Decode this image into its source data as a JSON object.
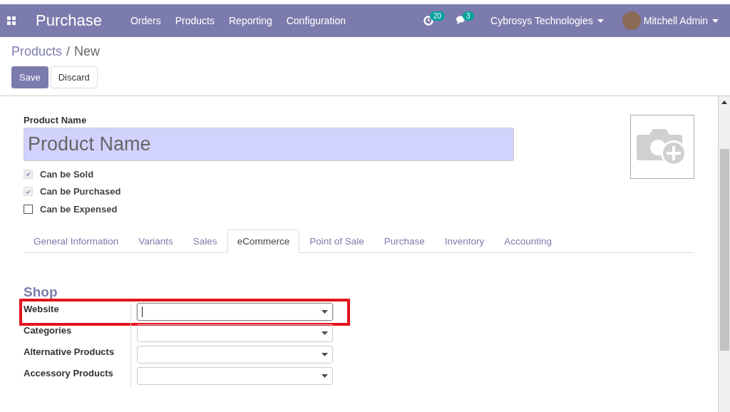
{
  "navbar": {
    "app_name": "Purchase",
    "menu": [
      "Orders",
      "Products",
      "Reporting",
      "Configuration"
    ],
    "activity_count": "20",
    "message_count": "3",
    "company": "Cybrosys Technologies",
    "user": "Mitchell Admin"
  },
  "breadcrumb": {
    "items": [
      "Products",
      "New"
    ],
    "separator": "/"
  },
  "buttons": [
    {
      "label": "Save",
      "kind": "primary"
    },
    {
      "label": "Discard",
      "kind": "secondary"
    }
  ],
  "form": {
    "name_label": "Product Name",
    "name_placeholder": "Product Name",
    "options": [
      {
        "label": "Can be Sold",
        "checked": true,
        "disabled": true
      },
      {
        "label": "Can be Purchased",
        "checked": true,
        "disabled": true
      },
      {
        "label": "Can be Expensed",
        "checked": false,
        "disabled": false
      }
    ],
    "tabs": [
      {
        "label": "General Information",
        "selected": false
      },
      {
        "label": "Variants",
        "selected": false
      },
      {
        "label": "Sales",
        "selected": false
      },
      {
        "label": "eCommerce",
        "selected": true
      },
      {
        "label": "Point of Sale",
        "selected": false
      },
      {
        "label": "Purchase",
        "selected": false
      },
      {
        "label": "Inventory",
        "selected": false
      },
      {
        "label": "Accounting",
        "selected": false
      }
    ],
    "section_title": "Shop",
    "fields": [
      {
        "label": "Website",
        "highlighted": true,
        "focused": true
      },
      {
        "label": "Categories",
        "highlighted": false,
        "focused": false
      },
      {
        "label": "Alternative Products",
        "highlighted": false,
        "focused": false
      },
      {
        "label": "Accessory Products",
        "highlighted": false,
        "focused": false
      }
    ]
  }
}
